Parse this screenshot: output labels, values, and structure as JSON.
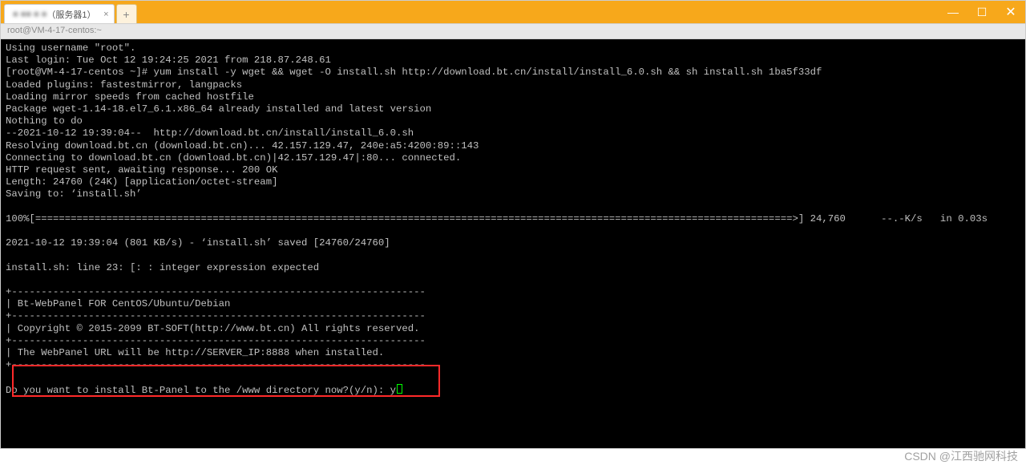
{
  "titlebar": {
    "tab_label_blur": "■ ■■ ■ ■",
    "tab_label_suffix": "（服务器1）",
    "close_glyph": "×",
    "add_glyph": "+",
    "win_min": "—",
    "win_max": "☐",
    "win_close": "✕"
  },
  "addressbar": {
    "text": "root@VM-4-17-centos:~"
  },
  "terminal": {
    "lines": [
      "Using username \"root\".",
      "Last login: Tue Oct 12 19:24:25 2021 from 218.87.248.61",
      "[root@VM-4-17-centos ~]# yum install -y wget && wget -O install.sh http://download.bt.cn/install/install_6.0.sh && sh install.sh 1ba5f33df",
      "Loaded plugins: fastestmirror, langpacks",
      "Loading mirror speeds from cached hostfile",
      "Package wget-1.14-18.el7_6.1.x86_64 already installed and latest version",
      "Nothing to do",
      "--2021-10-12 19:39:04--  http://download.bt.cn/install/install_6.0.sh",
      "Resolving download.bt.cn (download.bt.cn)... 42.157.129.47, 240e:a5:4200:89::143",
      "Connecting to download.bt.cn (download.bt.cn)|42.157.129.47|:80... connected.",
      "HTTP request sent, awaiting response... 200 OK",
      "Length: 24760 (24K) [application/octet-stream]",
      "Saving to: ‘install.sh’",
      "",
      "100%[================================================================================================================================>] 24,760      --.-K/s   in 0.03s",
      "",
      "2021-10-12 19:39:04 (801 KB/s) - ‘install.sh’ saved [24760/24760]",
      "",
      "install.sh: line 23: [: : integer expression expected",
      "",
      "+----------------------------------------------------------------------",
      "| Bt-WebPanel FOR CentOS/Ubuntu/Debian",
      "+----------------------------------------------------------------------",
      "| Copyright © 2015-2099 BT-SOFT(http://www.bt.cn) All rights reserved.",
      "+----------------------------------------------------------------------",
      "| The WebPanel URL will be http://SERVER_IP:8888 when installed.",
      "+----------------------------------------------------------------------",
      "",
      "Do you want to install Bt-Panel to the /www directory now?(y/n): y"
    ]
  },
  "watermark": "CSDN @江西驰网科技"
}
